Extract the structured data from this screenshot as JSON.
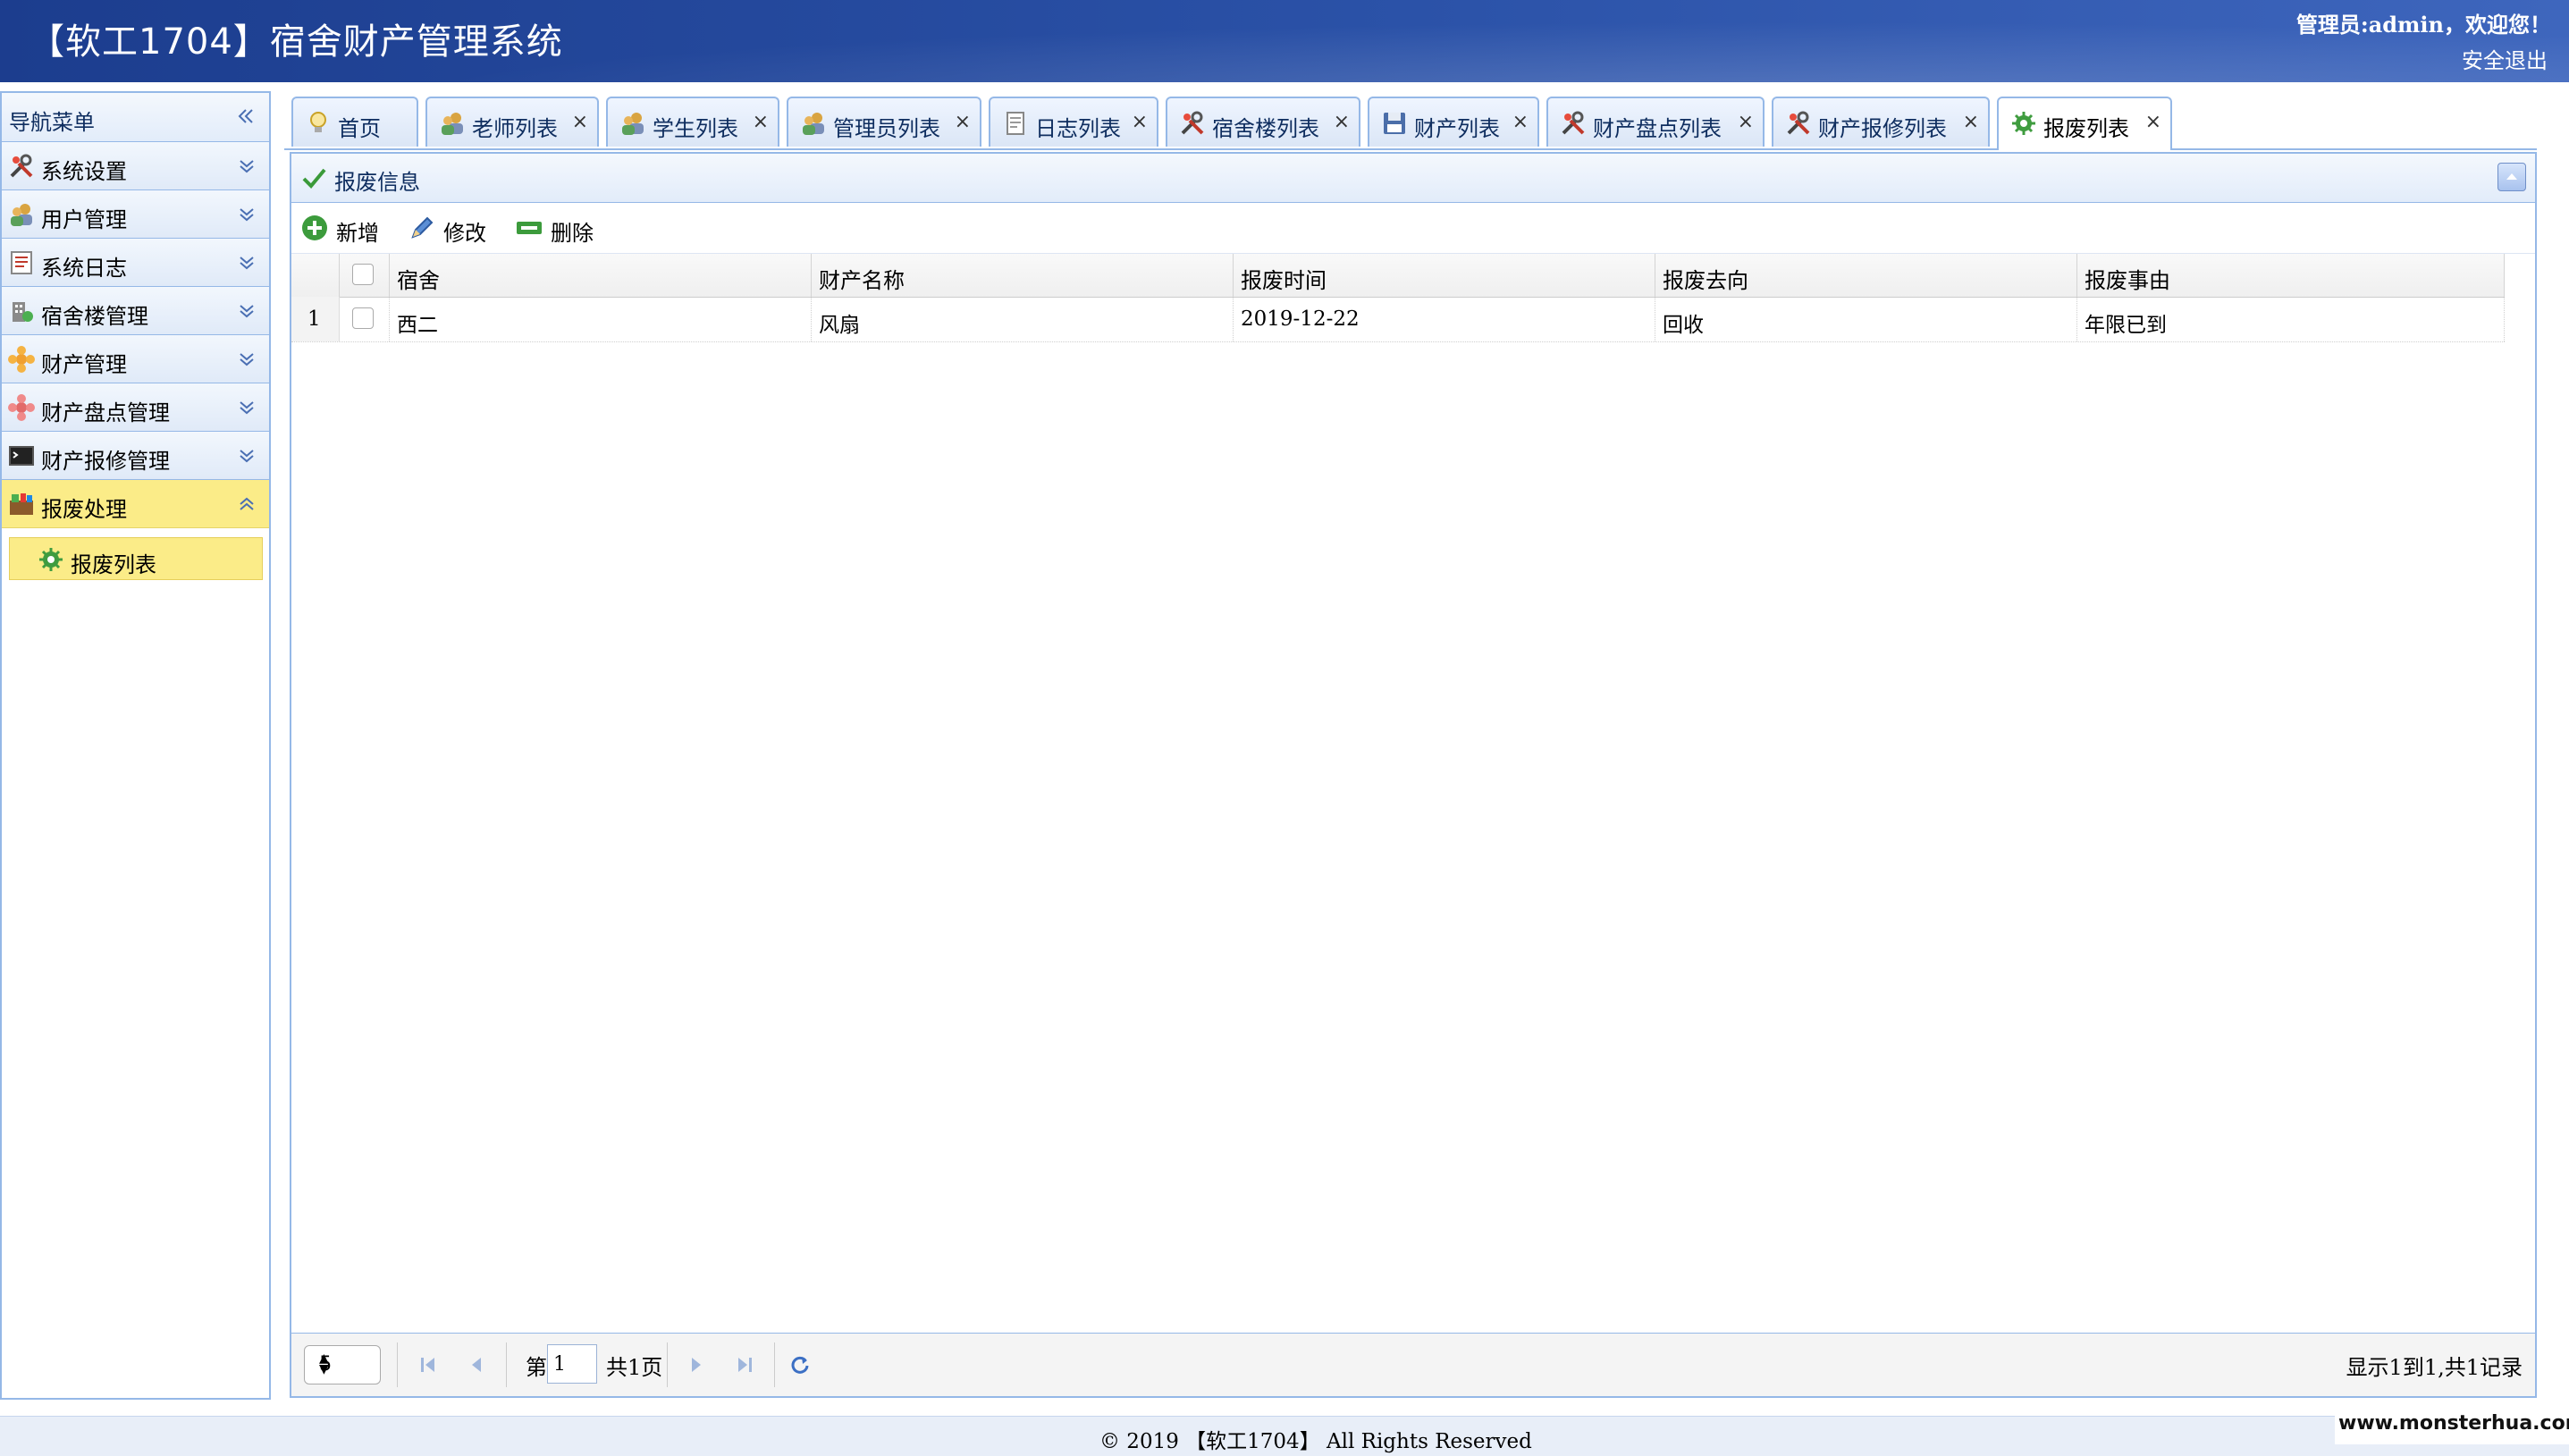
{
  "header": {
    "title": "【软工1704】宿舍财产管理系统",
    "welcome": "管理员:admin，欢迎您！",
    "logout": "安全退出"
  },
  "sidebar": {
    "title": "导航菜单",
    "items": [
      {
        "label": "系统设置",
        "icon": "tools-icon",
        "expanded": false
      },
      {
        "label": "用户管理",
        "icon": "users-icon",
        "expanded": false
      },
      {
        "label": "系统日志",
        "icon": "log-icon",
        "expanded": false
      },
      {
        "label": "宿舍楼管理",
        "icon": "building-icon",
        "expanded": false
      },
      {
        "label": "财产管理",
        "icon": "asset-icon",
        "expanded": false
      },
      {
        "label": "财产盘点管理",
        "icon": "inventory-icon",
        "expanded": false
      },
      {
        "label": "财产报修管理",
        "icon": "terminal-icon",
        "expanded": false
      },
      {
        "label": "报废处理",
        "icon": "scrap-icon",
        "expanded": true
      }
    ],
    "submenu": [
      {
        "label": "报废列表",
        "icon": "gear-icon"
      }
    ]
  },
  "tabs": [
    {
      "label": "首页",
      "icon": "home-icon",
      "closable": false
    },
    {
      "label": "老师列表",
      "icon": "users-icon",
      "closable": true
    },
    {
      "label": "学生列表",
      "icon": "users-icon",
      "closable": true
    },
    {
      "label": "管理员列表",
      "icon": "users-icon",
      "closable": true
    },
    {
      "label": "日志列表",
      "icon": "document-icon",
      "closable": true
    },
    {
      "label": "宿舍楼列表",
      "icon": "tools-icon",
      "closable": true
    },
    {
      "label": "财产列表",
      "icon": "save-icon",
      "closable": true
    },
    {
      "label": "财产盘点列表",
      "icon": "tools-icon",
      "closable": true
    },
    {
      "label": "财产报修列表",
      "icon": "tools-icon",
      "closable": true
    },
    {
      "label": "报废列表",
      "icon": "gear-icon",
      "closable": true,
      "selected": true
    }
  ],
  "tab_close": "×",
  "panel": {
    "title": "报废信息",
    "toolbar": {
      "add": "新增",
      "edit": "修改",
      "delete": "删除"
    }
  },
  "grid": {
    "columns": [
      "宿舍",
      "财产名称",
      "报废时间",
      "报废去向",
      "报废事由"
    ],
    "rows": [
      {
        "num": "1",
        "dorm": "西二",
        "asset": "风扇",
        "date": "2019-12-22",
        "destination": "回收",
        "reason": "年限已到"
      }
    ]
  },
  "pager": {
    "page_size": "5",
    "page_prefix": "第",
    "page_value": "1",
    "page_suffix": "共1页",
    "info": "显示1到1,共1记录"
  },
  "footer": {
    "text": "© 2019 【软工1704】 All Rights Reserved"
  },
  "watermark": "www.monsterhua.com",
  "colors": {
    "header_blue": "#2b52a8",
    "border_blue": "#95b8e7",
    "active_yellow": "#fbec88"
  }
}
